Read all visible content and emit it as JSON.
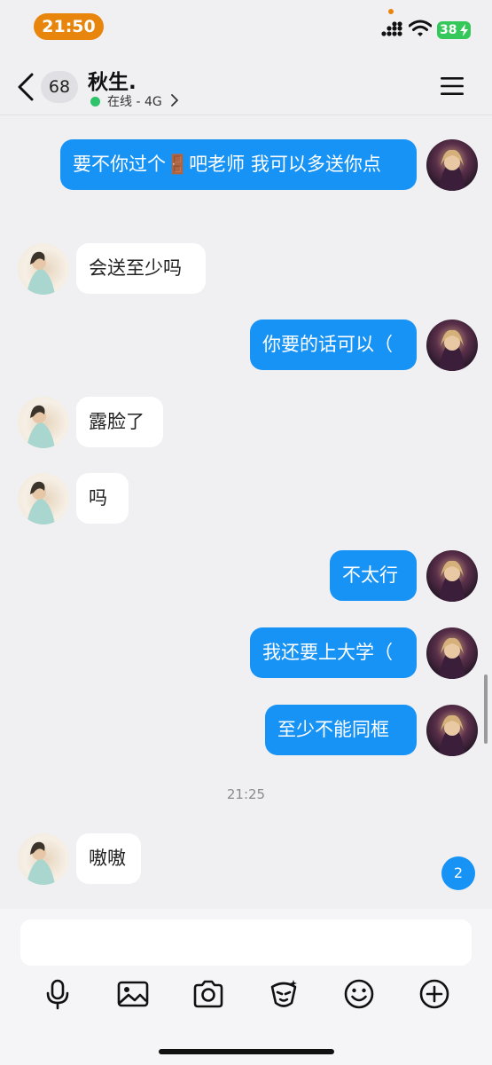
{
  "status_bar": {
    "time": "21:50",
    "battery": "38",
    "colors": {
      "time_pill": "#e8850d",
      "battery": "#34c759"
    }
  },
  "header": {
    "unread_count": "68",
    "contact_name": "秋生.",
    "online_status": "在线 - 4G",
    "icons": [
      "chevron-left-icon",
      "chevron-right-icon",
      "menu-icon"
    ]
  },
  "messages": [
    {
      "side": "me",
      "text": "要不你过个🚪吧老师 我可以多送你点"
    },
    {
      "side": "other",
      "text": "会送至少吗"
    },
    {
      "side": "me",
      "text": "你要的话可以（"
    },
    {
      "side": "other",
      "text": "露脸了"
    },
    {
      "side": "other",
      "text": "吗"
    },
    {
      "side": "me",
      "text": "不太行"
    },
    {
      "side": "me",
      "text": "我还要上大学（"
    },
    {
      "side": "me",
      "text": "至少不能同框"
    },
    {
      "side": "time",
      "text": "21:25"
    },
    {
      "side": "other",
      "text": "嗷嗷"
    }
  ],
  "new_message_badge": "2",
  "input": {
    "value": "",
    "placeholder": ""
  },
  "toolbar": {
    "icons": [
      "microphone-icon",
      "image-icon",
      "camera-icon",
      "sticker-icon",
      "emoji-icon",
      "plus-icon"
    ]
  },
  "colors": {
    "my_bubble": "#1792f5",
    "other_bubble": "#ffffff",
    "background": "#f0f0f2",
    "online": "#2dc36a"
  }
}
